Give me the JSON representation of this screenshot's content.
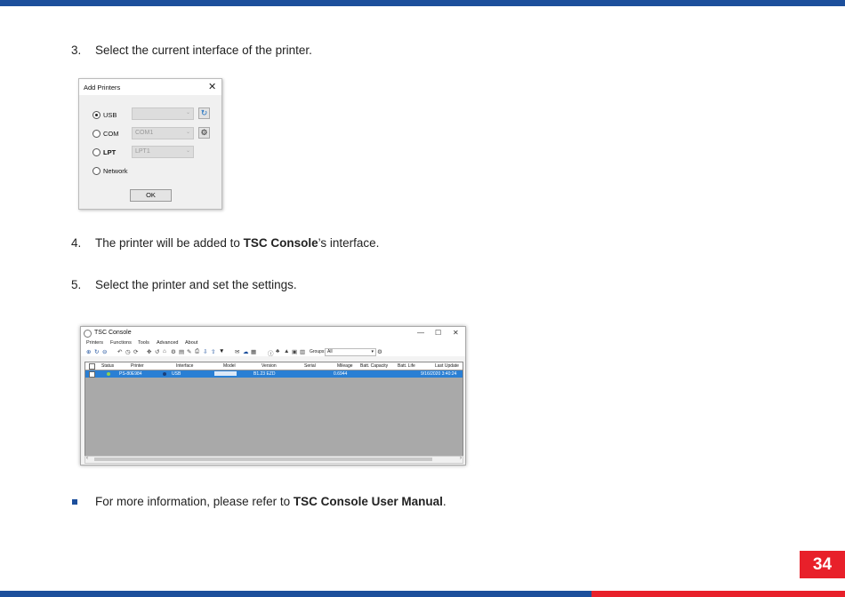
{
  "steps": [
    {
      "num": "3.",
      "text": "Select the current interface of the printer."
    },
    {
      "num": "4.",
      "text_before": "The printer will be added to ",
      "bold": "TSC Console",
      "text_after": "’s interface."
    },
    {
      "num": "5.",
      "text": "Select the printer and set the settings."
    }
  ],
  "note": {
    "text_before": "For more information, please refer to ",
    "bold": "TSC Console User Manual",
    "text_after": "."
  },
  "page_number": "34",
  "colors": {
    "brand_blue": "#1c4f9c",
    "brand_red": "#e8202a"
  },
  "add_printers_dialog": {
    "title": "Add Printers",
    "close_glyph": "✕",
    "options": [
      {
        "label": "USB",
        "selected": true,
        "value": "",
        "button_icon": "refresh-icon"
      },
      {
        "label": "COM",
        "selected": false,
        "value": "COM1",
        "button_icon": "gear-icon"
      },
      {
        "label": "LPT",
        "selected": false,
        "value": "LPT1"
      },
      {
        "label": "Network",
        "selected": false
      }
    ],
    "ok_label": "OK"
  },
  "tsc_console": {
    "title": "TSC Console",
    "window_controls": [
      "—",
      "☐",
      "✕"
    ],
    "menu": [
      "Printers",
      "Functions",
      "Tools",
      "Advanced",
      "About"
    ],
    "group_label": "Groups:",
    "group_value": "All",
    "columns": [
      "Status",
      "Printer",
      "Interface",
      "Model",
      "Version",
      "Serial",
      "Mileage",
      "Batt. Capacity",
      "Batt. Life",
      "Last Update"
    ],
    "row": {
      "printer": "PS-80E984",
      "interface": "USB",
      "model": "",
      "version": "B1.23 EZD",
      "serial": "",
      "mileage": "0.6944",
      "batt_capacity": "",
      "batt_life": "",
      "last_update": "9/16/2020 3:40:24"
    }
  }
}
